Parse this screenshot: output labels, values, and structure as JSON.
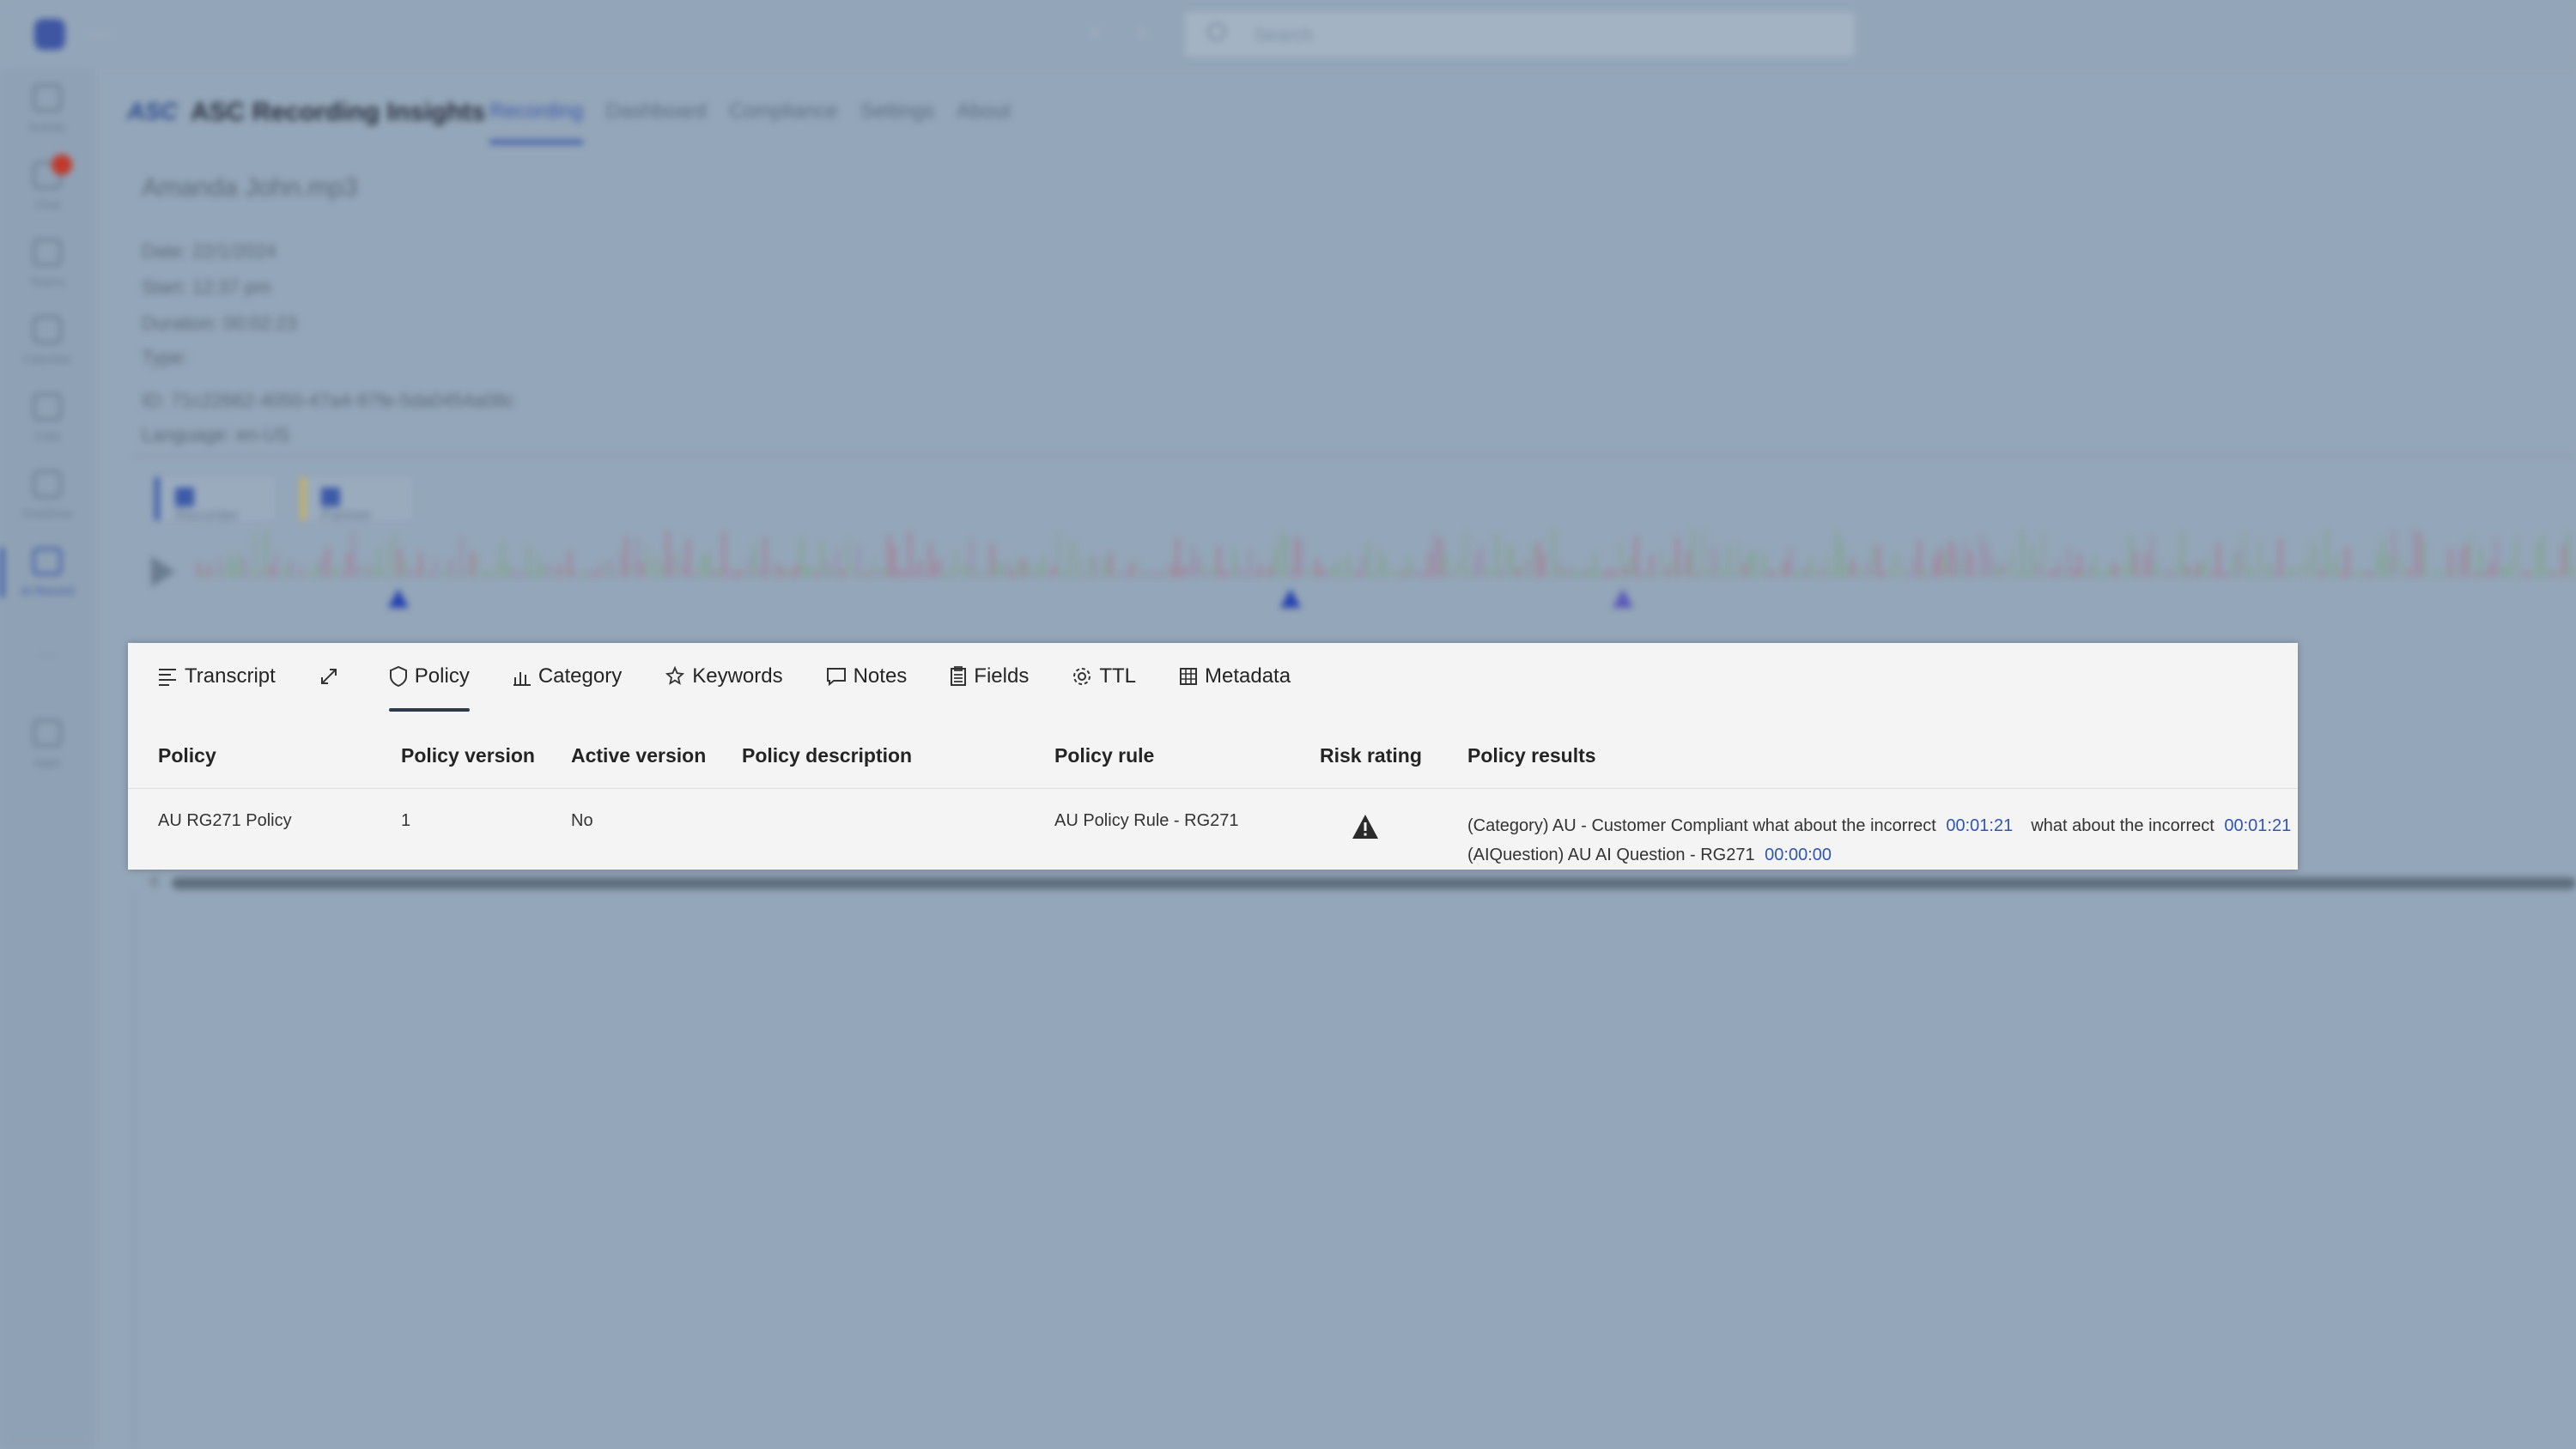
{
  "titlebar": {
    "more": "···",
    "back": "‹",
    "forward": "›",
    "search_placeholder": "Search"
  },
  "rail": {
    "items": [
      {
        "label": "Activity",
        "active": false,
        "badge": false
      },
      {
        "label": "Chat",
        "active": false,
        "badge": true
      },
      {
        "label": "Teams",
        "active": false,
        "badge": false
      },
      {
        "label": "Calendar",
        "active": false,
        "badge": false
      },
      {
        "label": "Calls",
        "active": false,
        "badge": false
      },
      {
        "label": "OneDrive",
        "active": false,
        "badge": false
      },
      {
        "label": "AI Record",
        "active": true,
        "badge": false
      },
      {
        "label": "···",
        "active": false,
        "badge": false
      },
      {
        "label": "Apps",
        "active": false,
        "badge": false
      }
    ]
  },
  "app": {
    "logo_text": "ASC",
    "title": "ASC Recording Insights",
    "tabs": [
      {
        "label": "Recording",
        "active": true
      },
      {
        "label": "Dashboard",
        "active": false
      },
      {
        "label": "Compliance",
        "active": false
      },
      {
        "label": "Settings",
        "active": false
      },
      {
        "label": "About",
        "active": false
      }
    ]
  },
  "recording": {
    "file_name": "Amanda John.mp3",
    "date": "Date: 22/1/2024",
    "start": "Start: 12:37 pm",
    "duration": "Duration: 00:02:23",
    "type": "Type:",
    "id": "ID: 71c22662-4050-47a4-97fe-5da0454a08c",
    "language": "Language: en-US",
    "speakers": [
      "Recorder",
      "Partner"
    ]
  },
  "panel": {
    "tabs": [
      {
        "label": "Transcript",
        "icon": "transcript-icon"
      },
      {
        "label": "",
        "icon": "expand-icon"
      },
      {
        "label": "Policy",
        "icon": "shield-icon",
        "active": true
      },
      {
        "label": "Category",
        "icon": "bar-chart-icon"
      },
      {
        "label": "Keywords",
        "icon": "keyword-icon"
      },
      {
        "label": "Notes",
        "icon": "note-icon"
      },
      {
        "label": "Fields",
        "icon": "clipboard-icon"
      },
      {
        "label": "TTL",
        "icon": "gear-icon"
      },
      {
        "label": "Metadata",
        "icon": "table-icon"
      }
    ],
    "columns": [
      "Policy",
      "Policy version",
      "Active version",
      "Policy description",
      "Policy rule",
      "Risk rating",
      "Policy results"
    ],
    "rows": [
      {
        "policy": "AU RG271 Policy",
        "policy_version": "1",
        "active_version": "No",
        "policy_description": "",
        "policy_rule": "AU Policy Rule - RG271",
        "risk_rating": "warning-icon",
        "results": {
          "line1_text": "(Category) AU - Customer Compliant what about the incorrect",
          "line1_ts1": "00:01:21",
          "line1_text2": "what about the incorrect",
          "line1_ts2": "00:01:21",
          "line2_text": "(AIQuestion) AU AI Question - RG271",
          "line2_ts": "00:00:00"
        }
      }
    ]
  }
}
